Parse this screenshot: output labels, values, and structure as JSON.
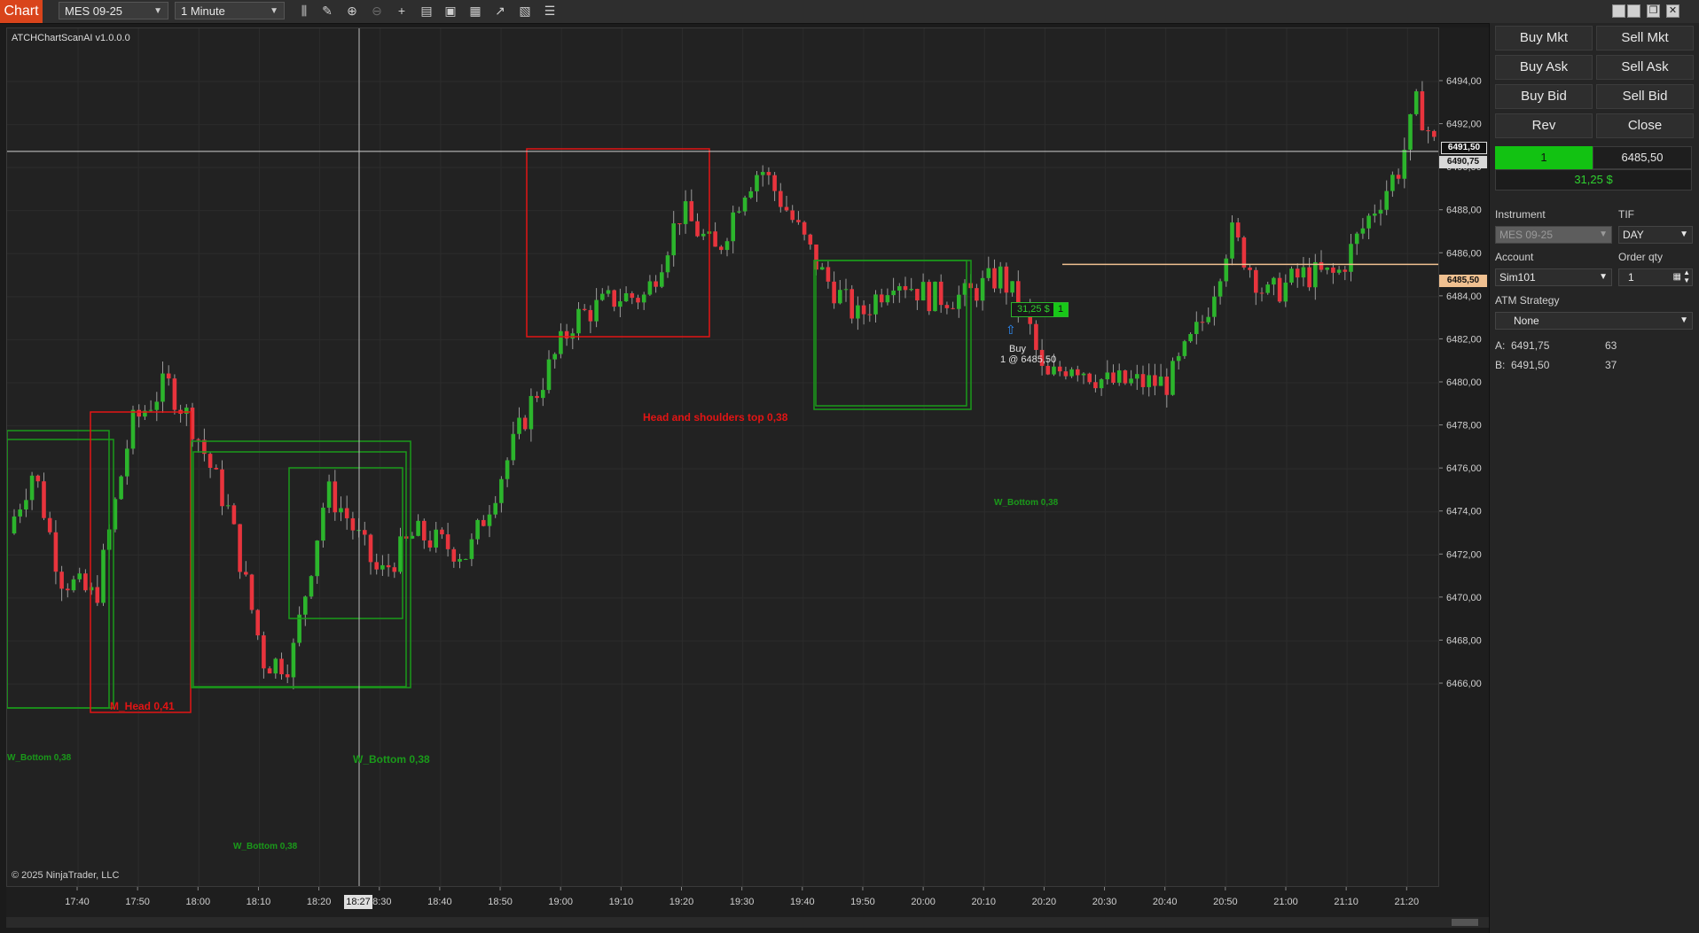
{
  "toolbar": {
    "chart_tab": "Chart",
    "instrument": "MES 09-25",
    "interval": "1 Minute",
    "icons": [
      "bars-icon",
      "draw-pencil-icon",
      "zoom-in-icon",
      "zoom-out-icon",
      "crosshair-icon",
      "properties-icon",
      "templates-icon",
      "strategies-icon",
      "indicators-icon",
      "data-box-icon",
      "list-icon"
    ],
    "window_buttons": [
      "minimize-icon",
      "restore-icon",
      "maximize-icon",
      "close-icon"
    ]
  },
  "chart": {
    "indicator_label": "ATCHChartScanAI v1.0.0.0",
    "copyright": "© 2025 NinjaTrader, LLC",
    "price_ticks": [
      "6494,00",
      "6492,00",
      "6490,00",
      "6488,00",
      "6486,00",
      "6484,00",
      "6482,00",
      "6480,00",
      "6478,00",
      "6476,00",
      "6474,00",
      "6472,00",
      "6470,00",
      "6468,00",
      "6466,00"
    ],
    "time_ticks": [
      "17:40",
      "17:50",
      "18:00",
      "18:10",
      "18:20",
      "18:30",
      "18:40",
      "18:50",
      "19:00",
      "19:10",
      "19:20",
      "19:30",
      "19:40",
      "19:50",
      "20:00",
      "20:10",
      "20:20",
      "20:30",
      "20:40",
      "20:50",
      "21:00",
      "21:10",
      "21:20"
    ],
    "crosshair_time": "18:27",
    "crosshair_price": "6490,75",
    "last_price": "6491,50",
    "position_price": "6485,50",
    "patterns": [
      {
        "label": "M_Head 0,41",
        "color": "#e31414"
      },
      {
        "label": "Head and shoulders top 0,38",
        "color": "#e31414"
      },
      {
        "label": "W_Bottom 0,38",
        "color": "#1a9a1a"
      },
      {
        "label": "W_Bottom 0,38",
        "color": "#1a9a1a"
      },
      {
        "label": "W_Bottom 0,38",
        "color": "#1a9a1a"
      },
      {
        "label": "W_Bottom 0,38",
        "color": "#1a9a1a"
      }
    ],
    "position_marker": {
      "pnl": "31,25 $",
      "qty": "1"
    },
    "execution": {
      "side": "Buy",
      "text": "1 @ 6485,50"
    },
    "colors": {
      "up": "#2cb52c",
      "down": "#e8343d",
      "background": "#222222",
      "position_line": "#f0c090"
    }
  },
  "panel": {
    "buttons": [
      [
        "Buy Mkt",
        "Sell Mkt"
      ],
      [
        "Buy Ask",
        "Sell Ask"
      ],
      [
        "Buy Bid",
        "Sell Bid"
      ],
      [
        "Rev",
        "Close"
      ]
    ],
    "position": {
      "qty": "1",
      "avg_price": "6485,50",
      "pnl": "31,25 $"
    },
    "instrument_label": "Instrument",
    "instrument_value": "MES 09-25",
    "tif_label": "TIF",
    "tif_value": "DAY",
    "account_label": "Account",
    "account_value": "Sim101",
    "order_qty_label": "Order qty",
    "order_qty_value": "1",
    "atm_label": "ATM Strategy",
    "atm_value": "None",
    "ask_label": "A:",
    "ask_price": "6491,75",
    "ask_size": "63",
    "bid_label": "B:",
    "bid_price": "6491,50",
    "bid_size": "37"
  }
}
